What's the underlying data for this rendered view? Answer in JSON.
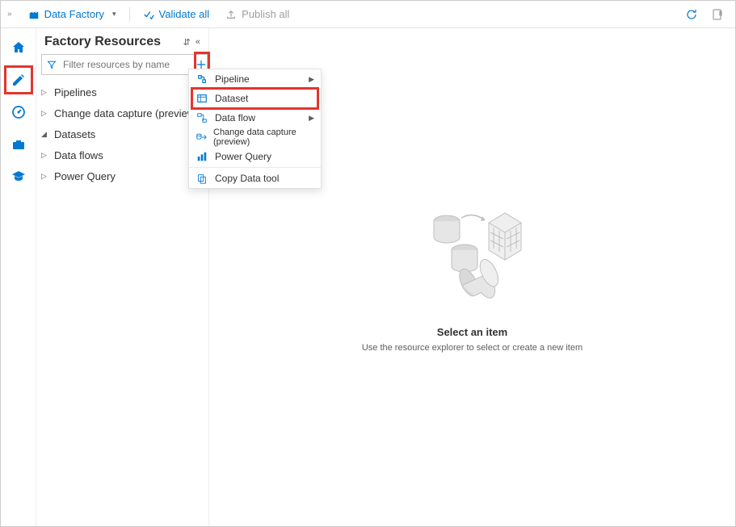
{
  "topbar": {
    "app_name": "Data Factory",
    "validate_label": "Validate all",
    "publish_label": "Publish all"
  },
  "panel": {
    "title": "Factory Resources",
    "filter_placeholder": "Filter resources by name"
  },
  "tree": [
    {
      "label": "Pipelines",
      "expanded": false
    },
    {
      "label": "Change data capture (preview)",
      "expanded": false
    },
    {
      "label": "Datasets",
      "expanded": true
    },
    {
      "label": "Data flows",
      "expanded": false
    },
    {
      "label": "Power Query",
      "expanded": false
    }
  ],
  "menu": {
    "items": [
      {
        "icon": "pipeline-icon",
        "label": "Pipeline",
        "submenu": true
      },
      {
        "icon": "dataset-icon",
        "label": "Dataset",
        "highlight": true
      },
      {
        "icon": "dataflow-icon",
        "label": "Data flow",
        "submenu": true
      },
      {
        "icon": "cdc-icon",
        "label": "Change data capture (preview)"
      },
      {
        "icon": "powerquery-icon",
        "label": "Power Query"
      },
      {
        "separator": true
      },
      {
        "icon": "copydata-icon",
        "label": "Copy Data tool"
      }
    ]
  },
  "empty": {
    "title": "Select an item",
    "subtitle": "Use the resource explorer to select or create a new item"
  }
}
